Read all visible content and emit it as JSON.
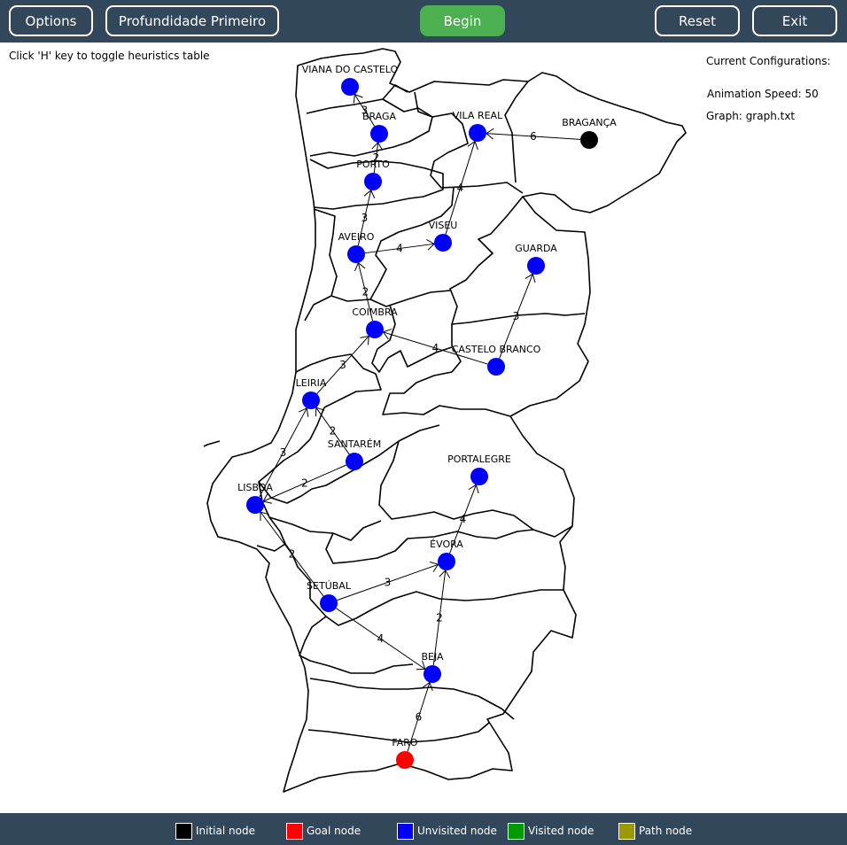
{
  "toolbar": {
    "options_label": "Options",
    "algorithm_label": "Profundidade Primeiro",
    "begin_label": "Begin",
    "reset_label": "Reset",
    "exit_label": "Exit"
  },
  "hint": "Click 'H' key to toggle heuristics table",
  "config": {
    "title": "Current Configurations:",
    "speed_label": "Animation Speed:",
    "speed_value": "50",
    "graph_label": "Graph:",
    "graph_value": "graph.txt"
  },
  "colors": {
    "initial": "#000000",
    "goal": "#ff0000",
    "unvisited": "#0000ff",
    "visited": "#009900",
    "path": "#999900"
  },
  "legend": [
    {
      "label": "Initial node",
      "color_key": "initial"
    },
    {
      "label": "Goal node",
      "color_key": "goal"
    },
    {
      "label": "Unvisited node",
      "color_key": "unvisited"
    },
    {
      "label": "Visited node",
      "color_key": "visited"
    },
    {
      "label": "Path node",
      "color_key": "path"
    }
  ],
  "nodes": [
    {
      "id": "viana",
      "label": "VIANA DO CASTELO",
      "state": "unvisited"
    },
    {
      "id": "braga",
      "label": "BRAGA",
      "state": "unvisited"
    },
    {
      "id": "vilareal",
      "label": "VILA REAL",
      "state": "unvisited"
    },
    {
      "id": "braganca",
      "label": "BRAGANÇA",
      "state": "initial"
    },
    {
      "id": "porto",
      "label": "PORTO",
      "state": "unvisited"
    },
    {
      "id": "aveiro",
      "label": "AVEIRO",
      "state": "unvisited"
    },
    {
      "id": "viseu",
      "label": "VISEU",
      "state": "unvisited"
    },
    {
      "id": "guarda",
      "label": "GUARDA",
      "state": "unvisited"
    },
    {
      "id": "coimbra",
      "label": "COIMBRA",
      "state": "unvisited"
    },
    {
      "id": "castelobranco",
      "label": "CASTELO BRANCO",
      "state": "unvisited"
    },
    {
      "id": "leiria",
      "label": "LEIRIA",
      "state": "unvisited"
    },
    {
      "id": "santarem",
      "label": "SANTARÉM",
      "state": "unvisited"
    },
    {
      "id": "portalegre",
      "label": "PORTALEGRE",
      "state": "unvisited"
    },
    {
      "id": "lisboa",
      "label": "LISBOA",
      "state": "unvisited"
    },
    {
      "id": "evora",
      "label": "ÉVORA",
      "state": "unvisited"
    },
    {
      "id": "setubal",
      "label": "SETÚBAL",
      "state": "unvisited"
    },
    {
      "id": "beja",
      "label": "BEJA",
      "state": "unvisited"
    },
    {
      "id": "faro",
      "label": "FARO",
      "state": "goal"
    }
  ],
  "edges": [
    {
      "from": "braga",
      "to": "viana",
      "weight": "3"
    },
    {
      "from": "porto",
      "to": "braga",
      "weight": "2"
    },
    {
      "from": "braganca",
      "to": "vilareal",
      "weight": "6"
    },
    {
      "from": "viseu",
      "to": "vilareal",
      "weight": "4"
    },
    {
      "from": "aveiro",
      "to": "porto",
      "weight": "3"
    },
    {
      "from": "aveiro",
      "to": "viseu",
      "weight": "4"
    },
    {
      "from": "coimbra",
      "to": "aveiro",
      "weight": "2"
    },
    {
      "from": "castelobranco",
      "to": "guarda",
      "weight": "3"
    },
    {
      "from": "castelobranco",
      "to": "coimbra",
      "weight": "4"
    },
    {
      "from": "leiria",
      "to": "coimbra",
      "weight": "3"
    },
    {
      "from": "santarem",
      "to": "leiria",
      "weight": "2"
    },
    {
      "from": "lisboa",
      "to": "leiria",
      "weight": "3"
    },
    {
      "from": "santarem",
      "to": "lisboa",
      "weight": "2"
    },
    {
      "from": "setubal",
      "to": "lisboa",
      "weight": "2"
    },
    {
      "from": "evora",
      "to": "portalegre",
      "weight": "4"
    },
    {
      "from": "setubal",
      "to": "evora",
      "weight": "3"
    },
    {
      "from": "beja",
      "to": "evora",
      "weight": "2"
    },
    {
      "from": "setubal",
      "to": "beja",
      "weight": "4"
    },
    {
      "from": "faro",
      "to": "beja",
      "weight": "6"
    }
  ]
}
